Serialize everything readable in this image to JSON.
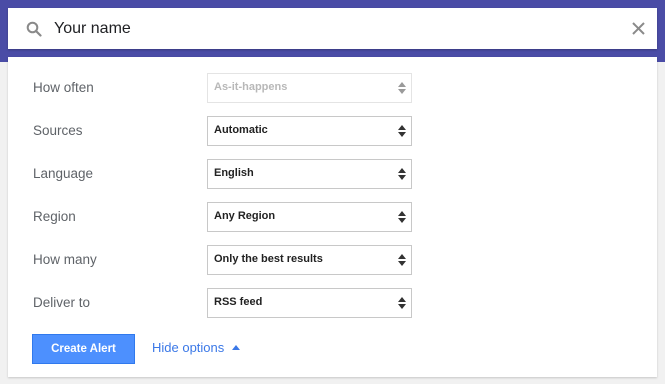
{
  "search": {
    "value": "Your name",
    "icon": "search-icon",
    "clear_icon": "close-icon"
  },
  "options": {
    "how_often": {
      "label": "How often",
      "value": "As-it-happens",
      "disabled": true
    },
    "sources": {
      "label": "Sources",
      "value": "Automatic"
    },
    "language": {
      "label": "Language",
      "value": "English"
    },
    "region": {
      "label": "Region",
      "value": "Any Region"
    },
    "how_many": {
      "label": "How many",
      "value": "Only the best results"
    },
    "deliver_to": {
      "label": "Deliver to",
      "value": "RSS feed"
    }
  },
  "actions": {
    "create_label": "Create Alert",
    "hide_options_label": "Hide options"
  },
  "colors": {
    "header": "#4a4ca6",
    "primary_button": "#4d90fe",
    "link": "#3b78e7"
  }
}
